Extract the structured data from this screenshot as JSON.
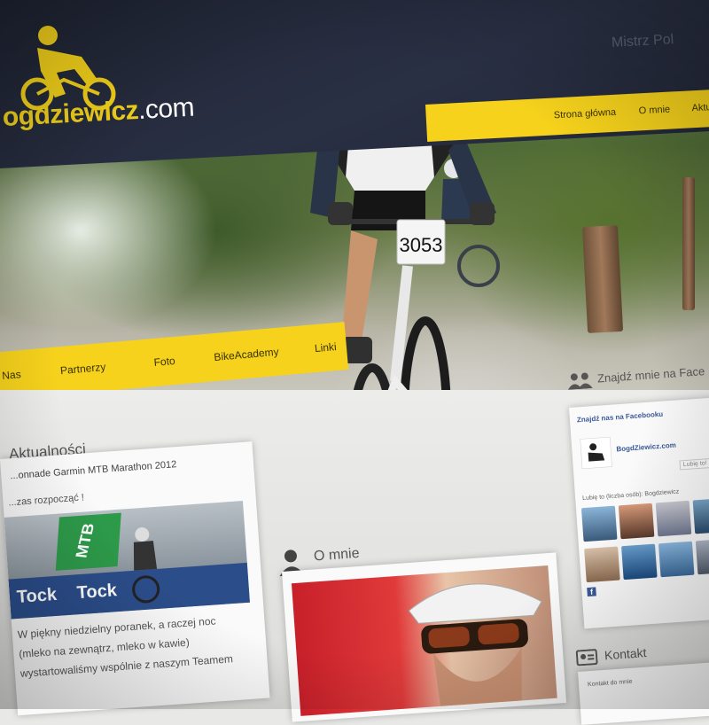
{
  "header": {
    "logo_text_main": "ogdziewicz",
    "logo_text_domain": ".com",
    "top_right_text": "Mistrz Pol"
  },
  "nav_top": {
    "items": [
      "Strona główna",
      "O mnie",
      "Aktu"
    ]
  },
  "nav_bottom": {
    "items": [
      "Nas",
      "Partnerzy",
      "Foto",
      "BikeAcademy",
      "Linki"
    ]
  },
  "hero": {
    "race_number": "3053"
  },
  "news": {
    "section_title": "Aktualności",
    "post_title": "...onnade Garmin MTB Marathon 2012",
    "post_sub": "...zas rozpocząć !",
    "banner_text": "MTB",
    "sponsor_text": "Tock",
    "lines": [
      "W piękny niedzielny poranek, a raczej noc",
      "(mleko na zewnątrz, mleko w kawie)",
      "wystartowaliśmy wspólnie z naszym Teamem"
    ]
  },
  "about": {
    "section_title": "O mnie"
  },
  "facebook": {
    "head_title": "Znajdź mnie na Face",
    "widget_title": "Znajdź nas na Facebooku",
    "page_name": "BogdZiewicz.com",
    "like_label": "Lubię to!",
    "count_text": "Lubię to (liczba osób): Bogdziewicz"
  },
  "contact": {
    "section_title": "Kontakt",
    "line": "Kontakt do mnie"
  },
  "colors": {
    "accent": "#f6d21c",
    "header_bg": "#222738",
    "facebook": "#3b5998"
  }
}
